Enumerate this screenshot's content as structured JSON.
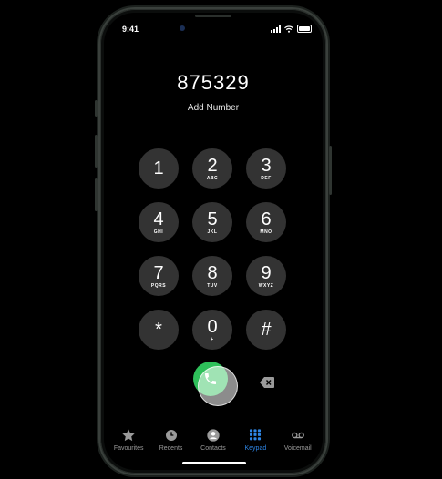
{
  "status": {
    "time": "9:41"
  },
  "dialer": {
    "number": "875329",
    "add_label": "Add Number"
  },
  "keys": [
    {
      "digit": "1",
      "letters": ""
    },
    {
      "digit": "2",
      "letters": "ABC"
    },
    {
      "digit": "3",
      "letters": "DEF"
    },
    {
      "digit": "4",
      "letters": "GHI"
    },
    {
      "digit": "5",
      "letters": "JKL"
    },
    {
      "digit": "6",
      "letters": "MNO"
    },
    {
      "digit": "7",
      "letters": "PQRS"
    },
    {
      "digit": "8",
      "letters": "TUV"
    },
    {
      "digit": "9",
      "letters": "WXYZ"
    },
    {
      "digit": "*",
      "letters": ""
    },
    {
      "digit": "0",
      "letters": "+"
    },
    {
      "digit": "#",
      "letters": ""
    }
  ],
  "tabs": [
    {
      "label": "Favourites",
      "icon": "star-icon"
    },
    {
      "label": "Recents",
      "icon": "clock-icon"
    },
    {
      "label": "Contacts",
      "icon": "person-icon"
    },
    {
      "label": "Keypad",
      "icon": "keypad-icon"
    },
    {
      "label": "Voicemail",
      "icon": "voicemail-icon"
    }
  ],
  "colors": {
    "call": "#2ec05a",
    "active_tab": "#2e86e6",
    "key_bg": "#333333"
  }
}
